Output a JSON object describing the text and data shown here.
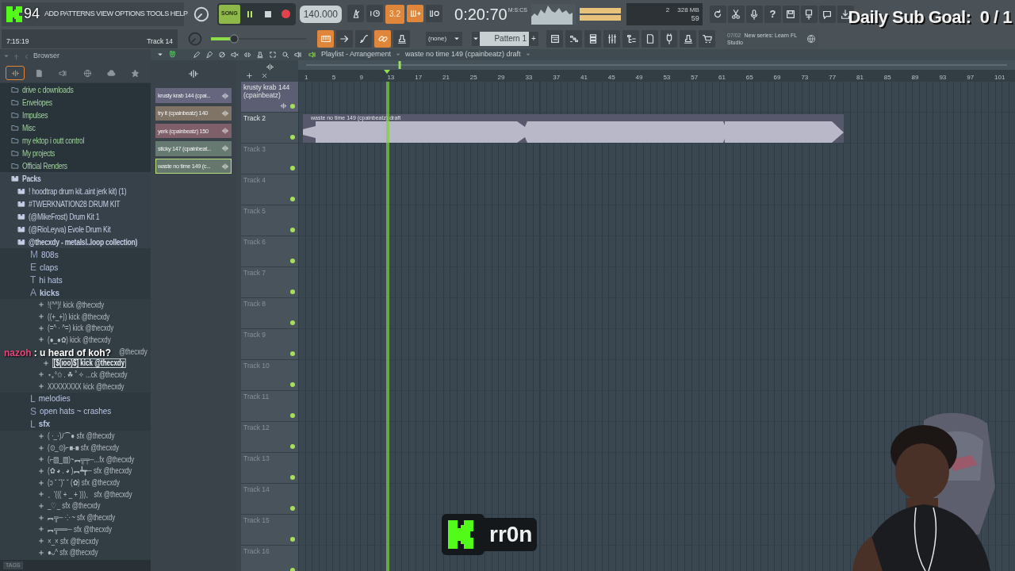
{
  "overlay": {
    "viewer_count": "94",
    "sub_goal": "Daily Sub Goal:  0 / 1",
    "chat": {
      "user": "nazoh",
      "message": ": u heard of koh?"
    },
    "streamer": "rr0n"
  },
  "menu": [
    "ADD",
    "PATTERNS",
    "VIEW",
    "OPTIONS",
    "TOOLS",
    "HELP"
  ],
  "master_pitch": {
    "level": 0.22
  },
  "hint_bar": {
    "time": "7:15:19",
    "track": "Track 14"
  },
  "transport": {
    "mode": "SONG",
    "playing": true,
    "tempo": "140.000",
    "time": "0:20:70",
    "time_label": "M:S:CS"
  },
  "toggles": [
    {
      "on": false
    },
    {
      "on": false
    },
    {
      "label": "3.2",
      "on": true
    },
    {
      "on": true
    },
    {
      "on": false
    }
  ],
  "toggles_row2": [
    {
      "on": true
    },
    {
      "on": false
    },
    {
      "on": false
    },
    {
      "on": true
    },
    {
      "on": false
    }
  ],
  "memory": {
    "cpu": "2",
    "ram": "328 MB",
    "polyphony": "59"
  },
  "help_button": "?",
  "pattern": {
    "channel": "(none)",
    "name": "Pattern 1",
    "add": "+"
  },
  "news": {
    "date": "07/02",
    "text": "New series: Learn FL Studio"
  },
  "browser": {
    "title": "Browser",
    "tabs": [
      {
        "selected": true
      },
      {
        "selected": false
      },
      {
        "selected": false
      },
      {
        "selected": false
      },
      {
        "selected": false
      },
      {
        "selected": false
      }
    ],
    "items": [
      {
        "kind": "folder",
        "label": "drive c downloads"
      },
      {
        "kind": "folder",
        "label": "Envelopes"
      },
      {
        "kind": "folder",
        "label": "Impulses"
      },
      {
        "kind": "folder",
        "label": "Misc"
      },
      {
        "kind": "folder",
        "label": "my ektop i outt control"
      },
      {
        "kind": "folder",
        "label": "My projects"
      },
      {
        "kind": "folder",
        "label": "Official Renders"
      },
      {
        "kind": "pack",
        "label": "Packs",
        "children": [
          {
            "kind": "pack",
            "label": "! hoodtrap drum kit..aint jerk kit) (1)"
          },
          {
            "kind": "pack",
            "label": "#TWERKNATION28 DRUM KIT"
          },
          {
            "kind": "pack",
            "label": "(@MikeFrost) Drum Kit 1"
          },
          {
            "kind": "pack",
            "label": "(@RioLeyva) Evole Drum Kit"
          },
          {
            "kind": "pack",
            "label": "@thecxdy - metalsl..loop collection)",
            "children": [
              {
                "kind": "category",
                "prefix": "M",
                "label": "808s"
              },
              {
                "kind": "category",
                "prefix": "E",
                "label": "claps"
              },
              {
                "kind": "category",
                "prefix": "T",
                "label": "hi hats"
              },
              {
                "kind": "category",
                "prefix": "A",
                "label": "kicks",
                "children": [
                  {
                    "kind": "sample",
                    "label": "!(^^)! kick @thecxdy",
                    "selected": false,
                    "covered": false
                  },
                  {
                    "kind": "sample",
                    "label": "((+_+)) kick @thecxdy",
                    "selected": false,
                    "covered": false
                  },
                  {
                    "kind": "sample",
                    "label": "(=^ · ^=) kick @thecxdy",
                    "selected": false,
                    "covered": false
                  },
                  {
                    "kind": "sample",
                    "label": "(●_●✿) kick @thecxdy",
                    "selected": false,
                    "covered": false
                  },
                  {
                    "kind": "sample",
                    "label": "@thecxdy",
                    "selected": false,
                    "covered": true
                  },
                  {
                    "kind": "sample",
                    "label": "[$(ıoo)$] kick @thecxdy",
                    "selected": true,
                    "covered": false
                  },
                  {
                    "kind": "sample",
                    "label": "⋆｡°✩ . ☘ ˚ ✧ ...ck @thecxdy",
                    "selected": false,
                    "covered": false
                  },
                  {
                    "kind": "sample",
                    "label": "XXXXXXXX kick @thecxdy",
                    "selected": false,
                    "covered": false
                  }
                ]
              },
              {
                "kind": "category",
                "prefix": "L",
                "label": "melodies"
              },
              {
                "kind": "category",
                "prefix": "S",
                "label": "open hats ~ crashes"
              },
              {
                "kind": "category",
                "prefix": "L",
                "label": "sfx",
                "children": [
                  {
                    "kind": "sample",
                    "label": "( ·_·)ﾉ⌒● sfx @thecxdy",
                    "selected": false
                  },
                  {
                    "kind": "sample",
                    "label": "(⊙_⊙)⌐■-■ sfx @thecxdy",
                    "selected": false
                  },
                  {
                    "kind": "sample",
                    "label": "(⌐▨_▨)~︻╦╤─...fx @thecxdy",
                    "selected": false
                  },
                  {
                    "kind": "sample",
                    "label": "(✿ ◕ . ◕ )︻┻┳─ sfx @thecxdy",
                    "selected": false
                  },
                  {
                    "kind": "sample",
                    "label": "(ↄ ˘ ˘)˘ ˘ (✿) sfx @thecxdy",
                    "selected": false
                  },
                  {
                    "kind": "sample",
                    "label": "。'((( + _ + )))。 sfx @thecxdy",
                    "selected": false
                  },
                  {
                    "kind": "sample",
                    "label": "_♡_ sfx @thecxdy",
                    "selected": false
                  },
                  {
                    "kind": "sample",
                    "label": "︻╦─ ⁘ ~ sfx @thecxdy",
                    "selected": false
                  },
                  {
                    "kind": "sample",
                    "label": "︻╦══─ sfx @thecxdy",
                    "selected": false
                  },
                  {
                    "kind": "sample",
                    "label": "×_× sfx @thecxdy",
                    "selected": false
                  },
                  {
                    "kind": "sample",
                    "label": "●ᴗ^ sfx @thecxdy",
                    "selected": false
                  }
                ]
              }
            ]
          }
        ]
      }
    ],
    "tags_label": "TAGS"
  },
  "clips": [
    {
      "label": "krusty krab 144 (cpai...",
      "color": "#66667f",
      "selected": false
    },
    {
      "label": "try it (cpainbeatz) 140",
      "color": "#7f7466",
      "selected": false
    },
    {
      "label": "yerk (cpainbeatz) 150",
      "color": "#7f5f6a",
      "selected": false
    },
    {
      "label": "sticky 147 (cpainbeat...",
      "color": "#667a72",
      "selected": false
    },
    {
      "label": "waste no time 149 (c...",
      "color": "#66786e",
      "selected": true
    }
  ],
  "playlist": {
    "title": "Playlist - Arrangement",
    "clip_name": "waste no time 149 (cpainbeatz) draft",
    "ruler": [
      "1",
      "5",
      "9",
      "13",
      "17",
      "21",
      "25",
      "29",
      "33",
      "37",
      "41",
      "45",
      "49",
      "53",
      "57",
      "61",
      "65",
      "69",
      "73",
      "77",
      "81",
      "85",
      "89",
      "93",
      "97",
      "101"
    ],
    "tracks": [
      {
        "name": "krusty krab 144 (cpainbeatz)",
        "active": true
      },
      {
        "name": "Track 2",
        "active": true,
        "clip": "waste no time 149 (cpainbeatz) draft"
      },
      {
        "name": "Track 3",
        "active": false
      },
      {
        "name": "Track 4",
        "active": false
      },
      {
        "name": "Track 5",
        "active": false
      },
      {
        "name": "Track 6",
        "active": false
      },
      {
        "name": "Track 7",
        "active": false
      },
      {
        "name": "Track 8",
        "active": false
      },
      {
        "name": "Track 9",
        "active": false
      },
      {
        "name": "Track 10",
        "active": false
      },
      {
        "name": "Track 11",
        "active": false
      },
      {
        "name": "Track 12",
        "active": false
      },
      {
        "name": "Track 13",
        "active": false
      },
      {
        "name": "Track 14",
        "active": false
      },
      {
        "name": "Track 15",
        "active": false
      },
      {
        "name": "Track 16",
        "active": false
      }
    ]
  }
}
